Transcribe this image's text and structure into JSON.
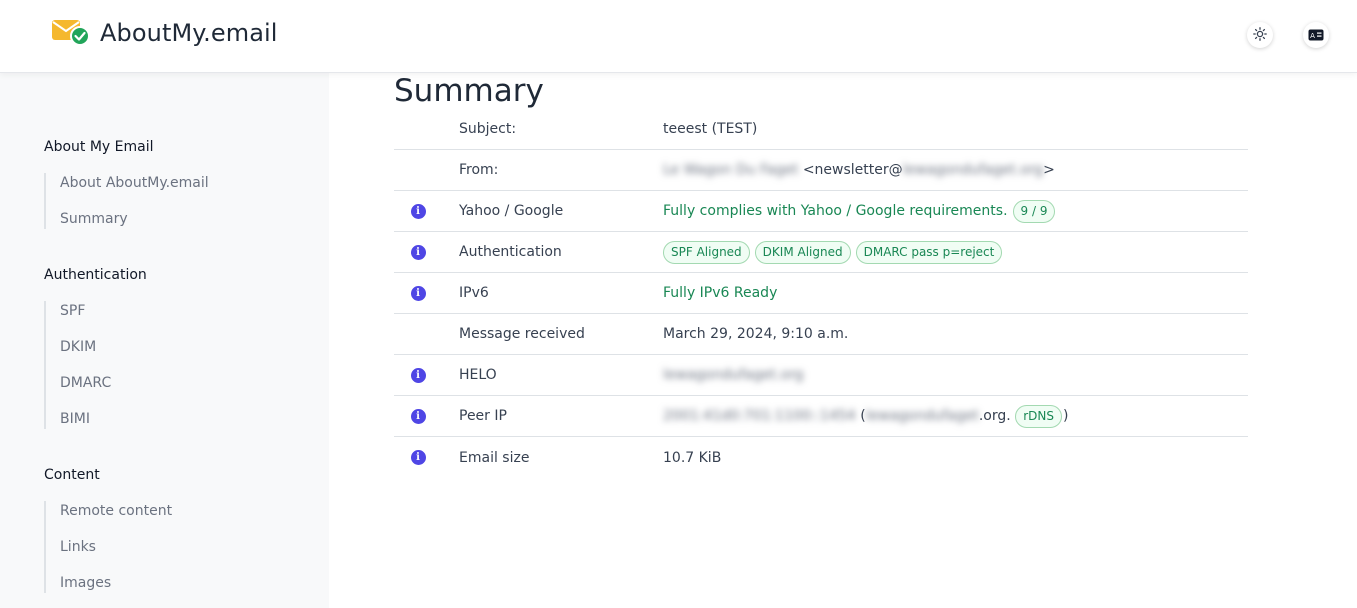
{
  "header": {
    "brand": "AboutMy.email",
    "theme_toggle_icon": "sun-icon",
    "language_icon": "language-card-icon"
  },
  "sidebar": {
    "sections": [
      {
        "heading": "About My Email",
        "items": [
          "About AboutMy.email",
          "Summary"
        ]
      },
      {
        "heading": "Authentication",
        "items": [
          "SPF",
          "DKIM",
          "DMARC",
          "BIMI"
        ]
      },
      {
        "heading": "Content",
        "items": [
          "Remote content",
          "Links",
          "Images"
        ]
      }
    ]
  },
  "main": {
    "title": "Summary",
    "rows": {
      "subject": {
        "label": "Subject:",
        "value": "teeest (TEST)"
      },
      "from": {
        "label": "From:",
        "name_blurred": "Le Wagon Du Faget",
        "prefix": "<newsletter@",
        "domain_blurred": "lewagondufaget.org",
        "suffix": ">"
      },
      "yahoo": {
        "label": "Yahoo / Google",
        "value": "Fully complies with Yahoo / Google requirements.",
        "badge": "9 / 9"
      },
      "auth": {
        "label": "Authentication",
        "badges": [
          "SPF Aligned",
          "DKIM Aligned",
          "DMARC pass p=reject"
        ]
      },
      "ipv6": {
        "label": "IPv6",
        "value": "Fully IPv6 Ready"
      },
      "received": {
        "label": "Message received",
        "value": "March 29, 2024, 9:10 a.m."
      },
      "helo": {
        "label": "HELO",
        "value_blurred": "lewagondufaget.org"
      },
      "peer": {
        "label": "Peer IP",
        "ip_blurred": "2001:41d0:701:1100::1454",
        "open": "(",
        "host_blurred": "lewagondufaget",
        "host_suffix": ".org.",
        "badge": "rDNS",
        "close": ")"
      },
      "size": {
        "label": "Email size",
        "value": "10.7 KiB"
      }
    }
  },
  "colors": {
    "accent": "#4f46e5",
    "success": "#198754",
    "logo_envelope": "#f5b82e",
    "logo_check": "#22a55a"
  }
}
